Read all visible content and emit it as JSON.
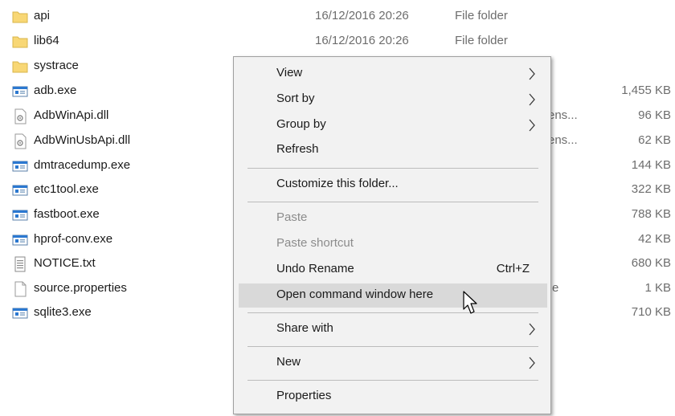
{
  "files": [
    {
      "name": "api",
      "date": "16/12/2016 20:26",
      "type": "File folder",
      "size": "",
      "icon": "folder-icon"
    },
    {
      "name": "lib64",
      "date": "16/12/2016 20:26",
      "type": "File folder",
      "size": "",
      "icon": "folder-icon"
    },
    {
      "name": "systrace",
      "date": "",
      "type": "",
      "size": "",
      "icon": "folder-icon"
    },
    {
      "name": "adb.exe",
      "date": "",
      "type": "",
      "size": "1,455 KB",
      "icon": "exe-icon"
    },
    {
      "name": "AdbWinApi.dll",
      "date": "",
      "type": "ens...",
      "size": "96 KB",
      "icon": "dll-icon"
    },
    {
      "name": "AdbWinUsbApi.dll",
      "date": "",
      "type": "ens...",
      "size": "62 KB",
      "icon": "dll-icon"
    },
    {
      "name": "dmtracedump.exe",
      "date": "",
      "type": "",
      "size": "144 KB",
      "icon": "exe-icon"
    },
    {
      "name": "etc1tool.exe",
      "date": "",
      "type": "",
      "size": "322 KB",
      "icon": "exe-icon"
    },
    {
      "name": "fastboot.exe",
      "date": "",
      "type": "",
      "size": "788 KB",
      "icon": "exe-icon"
    },
    {
      "name": "hprof-conv.exe",
      "date": "",
      "type": "",
      "size": "42 KB",
      "icon": "exe-icon"
    },
    {
      "name": "NOTICE.txt",
      "date": "",
      "type": "",
      "size": "680 KB",
      "icon": "text-file-icon"
    },
    {
      "name": "source.properties",
      "date": "",
      "type": "e",
      "size": "1 KB",
      "icon": "blank-file-icon"
    },
    {
      "name": "sqlite3.exe",
      "date": "",
      "type": "",
      "size": "710 KB",
      "icon": "exe-icon"
    }
  ],
  "context_menu": {
    "items": [
      {
        "label": "View",
        "submenu": true,
        "disabled": false
      },
      {
        "label": "Sort by",
        "submenu": true,
        "disabled": false
      },
      {
        "label": "Group by",
        "submenu": true,
        "disabled": false
      },
      {
        "label": "Refresh",
        "submenu": false,
        "disabled": false
      },
      {
        "label": "Customize this folder...",
        "submenu": false,
        "disabled": false
      },
      {
        "label": "Paste",
        "submenu": false,
        "disabled": true
      },
      {
        "label": "Paste shortcut",
        "submenu": false,
        "disabled": true
      },
      {
        "label": "Undo Rename",
        "shortcut": "Ctrl+Z",
        "submenu": false,
        "disabled": false
      },
      {
        "label": "Open command window here",
        "submenu": false,
        "disabled": false,
        "hovered": true
      },
      {
        "label": "Share with",
        "submenu": true,
        "disabled": false
      },
      {
        "label": "New",
        "submenu": true,
        "disabled": false
      },
      {
        "label": "Properties",
        "submenu": false,
        "disabled": false
      }
    ]
  },
  "colors": {
    "folder": "#f8d775",
    "exe_blue": "#2b78d0",
    "menu_bg": "#f2f2f2",
    "menu_hover": "#d9d9d9"
  }
}
